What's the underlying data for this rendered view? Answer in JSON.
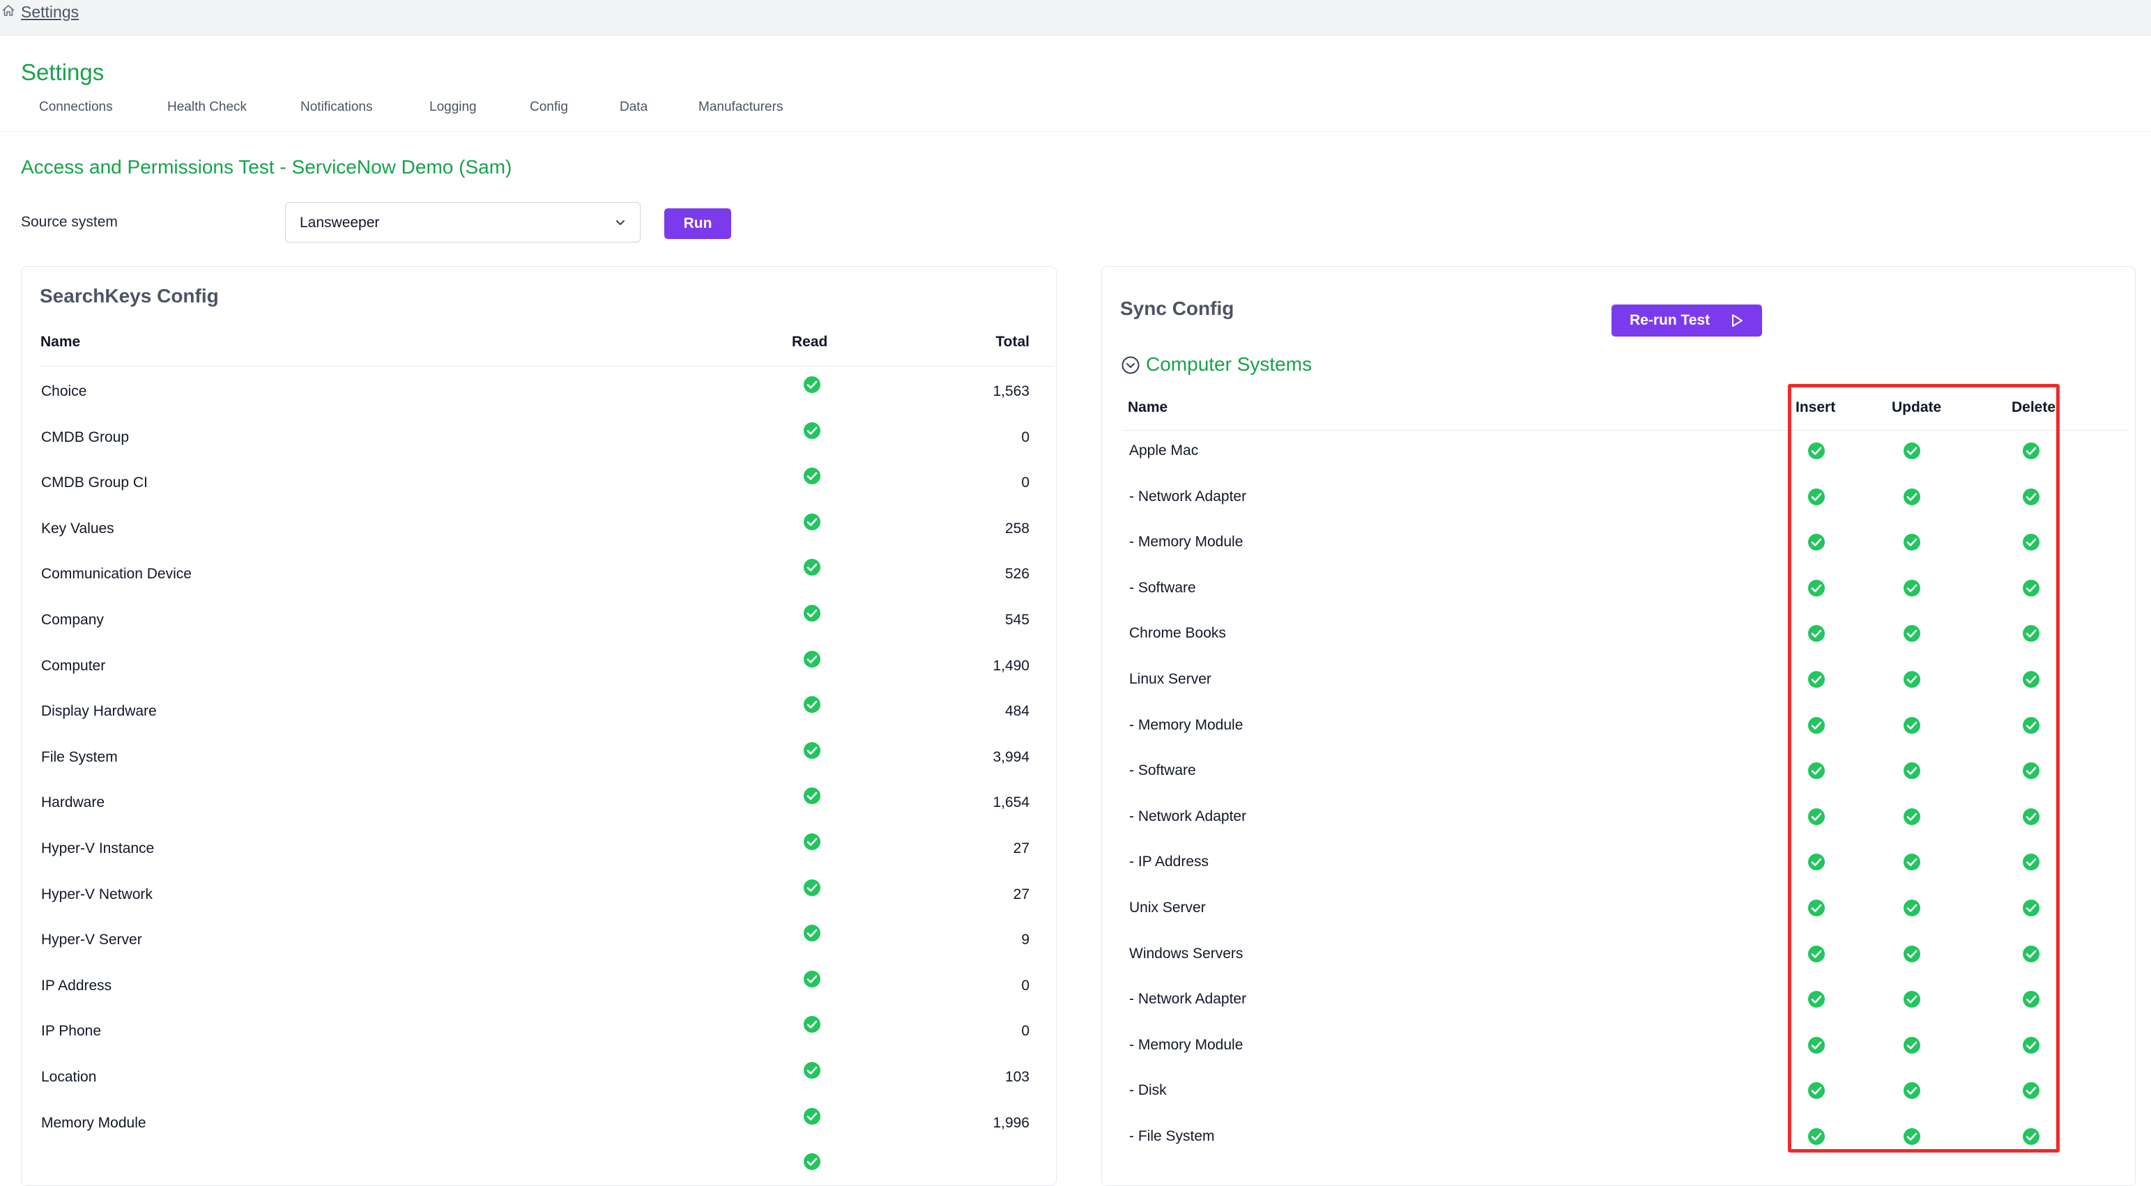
{
  "breadcrumb": {
    "label": "Settings",
    "icon": "home-icon"
  },
  "page_title": "Settings",
  "tabs": [
    {
      "label": "Connections"
    },
    {
      "label": "Health Check"
    },
    {
      "label": "Notifications"
    },
    {
      "label": "Logging"
    },
    {
      "label": "Config"
    },
    {
      "label": "Data"
    },
    {
      "label": "Manufacturers"
    }
  ],
  "section_title": "Access and Permissions Test - ServiceNow Demo (Sam)",
  "source": {
    "label": "Source system",
    "value": "Lansweeper",
    "run_label": "Run"
  },
  "colors": {
    "accent_green": "#16a34a",
    "button_purple": "#7c3aed",
    "check_green": "#22c55e",
    "highlight_red": "#ef2b2b"
  },
  "searchkeys": {
    "title": "SearchKeys Config",
    "headers": {
      "name": "Name",
      "read": "Read",
      "total": "Total"
    },
    "rows": [
      {
        "name": "Choice",
        "total": "1,563"
      },
      {
        "name": "CMDB Group",
        "total": "0"
      },
      {
        "name": "CMDB Group CI",
        "total": "0"
      },
      {
        "name": "Key Values",
        "total": "258"
      },
      {
        "name": "Communication Device",
        "total": "526"
      },
      {
        "name": "Company",
        "total": "545"
      },
      {
        "name": "Computer",
        "total": "1,490"
      },
      {
        "name": "Display Hardware",
        "total": "484"
      },
      {
        "name": "File System",
        "total": "3,994"
      },
      {
        "name": "Hardware",
        "total": "1,654"
      },
      {
        "name": "Hyper-V Instance",
        "total": "27"
      },
      {
        "name": "Hyper-V Network",
        "total": "27"
      },
      {
        "name": "Hyper-V Server",
        "total": "9"
      },
      {
        "name": "IP Address",
        "total": "0"
      },
      {
        "name": "IP Phone",
        "total": "0"
      },
      {
        "name": "Location",
        "total": "103"
      },
      {
        "name": "Memory Module",
        "total": "1,996"
      },
      {
        "name": "",
        "total": ""
      }
    ]
  },
  "sync": {
    "title": "Sync Config",
    "rerun_label": "Re-run Test",
    "group_title": "Computer Systems",
    "headers": {
      "name": "Name",
      "insert": "Insert",
      "update": "Update",
      "delete": "Delete"
    },
    "rows": [
      {
        "name": "Apple Mac"
      },
      {
        "name": "- Network Adapter"
      },
      {
        "name": "- Memory Module"
      },
      {
        "name": "- Software"
      },
      {
        "name": "Chrome Books"
      },
      {
        "name": "Linux Server"
      },
      {
        "name": "- Memory Module"
      },
      {
        "name": "- Software"
      },
      {
        "name": "- Network Adapter"
      },
      {
        "name": "- IP Address"
      },
      {
        "name": "Unix Server"
      },
      {
        "name": "Windows Servers"
      },
      {
        "name": "- Network Adapter"
      },
      {
        "name": "- Memory Module"
      },
      {
        "name": "- Disk"
      },
      {
        "name": "- File System"
      }
    ]
  }
}
